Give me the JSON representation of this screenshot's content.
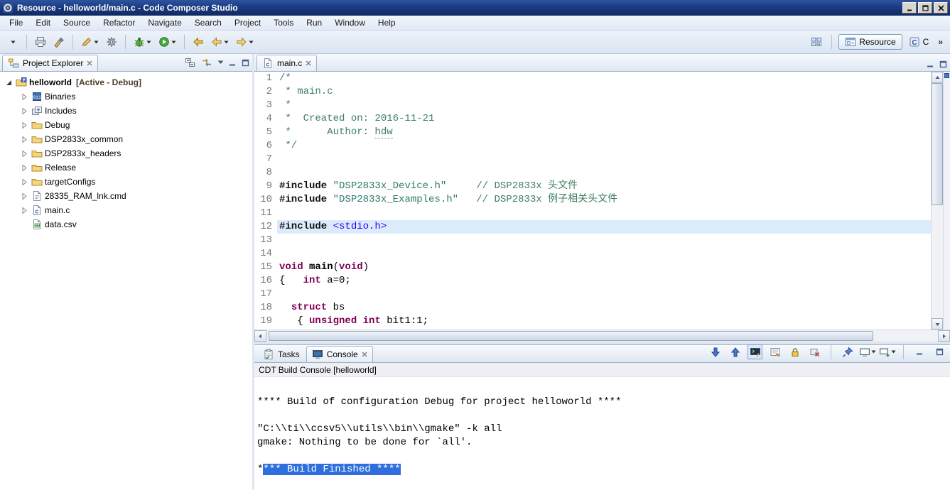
{
  "window": {
    "title": "Resource - helloworld/main.c - Code Composer Studio"
  },
  "menu": {
    "items": [
      "File",
      "Edit",
      "Source",
      "Refactor",
      "Navigate",
      "Search",
      "Project",
      "Tools",
      "Run",
      "Window",
      "Help"
    ]
  },
  "toolbar": {
    "groups": [
      [
        {
          "name": "new-button",
          "icon": "caret"
        }
      ],
      [
        {
          "name": "print-button",
          "icon": "printer"
        },
        {
          "name": "paint-button",
          "icon": "brush"
        }
      ],
      [
        {
          "name": "edit-button",
          "icon": "pencil",
          "dropdown": true
        },
        {
          "name": "settings-button",
          "icon": "gear"
        }
      ],
      [
        {
          "name": "debug-button",
          "icon": "bug",
          "dropdown": true
        },
        {
          "name": "run-button",
          "icon": "run",
          "dropdown": true
        }
      ],
      [
        {
          "name": "back-button",
          "icon": "back"
        },
        {
          "name": "back-history-button",
          "icon": "navleft",
          "dropdown": true
        },
        {
          "name": "forward-history-button",
          "icon": "navright",
          "dropdown": true
        }
      ]
    ]
  },
  "perspective_bar": {
    "resource_label": "Resource",
    "c_label": "C",
    "overflow": "»"
  },
  "project_explorer": {
    "tab_label": "Project Explorer",
    "toolbar": [
      {
        "name": "collapse-all-button",
        "icon": "collapseall"
      },
      {
        "name": "link-with-editor-button",
        "icon": "link"
      },
      {
        "name": "view-menu-button",
        "icon": "viewmenu"
      },
      {
        "name": "minimize-view-button",
        "icon": "minbtn"
      },
      {
        "name": "maximize-view-button",
        "icon": "maxbtn"
      }
    ],
    "root": {
      "label": "helloworld",
      "decoration": "[Active - Debug]"
    },
    "items": [
      {
        "label": "Binaries",
        "icon": "binaries",
        "expandable": true
      },
      {
        "label": "Includes",
        "icon": "includes",
        "expandable": true
      },
      {
        "label": "Debug",
        "icon": "folder",
        "expandable": true
      },
      {
        "label": "DSP2833x_common",
        "icon": "folder",
        "expandable": true
      },
      {
        "label": "DSP2833x_headers",
        "icon": "folder",
        "expandable": true
      },
      {
        "label": "Release",
        "icon": "folder",
        "expandable": true
      },
      {
        "label": "targetConfigs",
        "icon": "folder",
        "expandable": true
      },
      {
        "label": "28335_RAM_lnk.cmd",
        "icon": "cmd",
        "expandable": true
      },
      {
        "label": "main.c",
        "icon": "cfile",
        "expandable": true
      },
      {
        "label": "data.csv",
        "icon": "csv",
        "expandable": false
      }
    ]
  },
  "editor": {
    "tab_label": "main.c",
    "lines": [
      {
        "n": 1,
        "s": [
          {
            "t": "/*",
            "c": "cm"
          }
        ]
      },
      {
        "n": 2,
        "s": [
          {
            "t": " * main.c",
            "c": "cm"
          }
        ]
      },
      {
        "n": 3,
        "s": [
          {
            "t": " *",
            "c": "cm"
          }
        ]
      },
      {
        "n": 4,
        "s": [
          {
            "t": " *  Created on: 2016-11-21",
            "c": "cm"
          }
        ]
      },
      {
        "n": 5,
        "s": [
          {
            "t": " *      Author: ",
            "c": "cm"
          },
          {
            "t": "hdw",
            "c": "cm spell"
          }
        ]
      },
      {
        "n": 6,
        "s": [
          {
            "t": " */",
            "c": "cm"
          }
        ]
      },
      {
        "n": 7,
        "s": []
      },
      {
        "n": 8,
        "s": []
      },
      {
        "n": 9,
        "s": [
          {
            "t": "#include",
            "c": "pp"
          },
          {
            "t": " ",
            "c": ""
          },
          {
            "t": "\"DSP2833x_Device.h\"",
            "c": "str"
          },
          {
            "t": "     ",
            "c": ""
          },
          {
            "t": "// DSP2833x 头文件",
            "c": "cm"
          }
        ]
      },
      {
        "n": 10,
        "s": [
          {
            "t": "#include",
            "c": "pp"
          },
          {
            "t": " ",
            "c": ""
          },
          {
            "t": "\"DSP2833x_Examples.h\"",
            "c": "str"
          },
          {
            "t": "   ",
            "c": ""
          },
          {
            "t": "// DSP2833x 例子相关头文件",
            "c": "cm"
          }
        ]
      },
      {
        "n": 11,
        "s": []
      },
      {
        "n": 12,
        "hl": true,
        "s": [
          {
            "t": "#include",
            "c": "pp"
          },
          {
            "t": " ",
            "c": ""
          },
          {
            "t": "<stdio.h>",
            "c": "inc"
          }
        ]
      },
      {
        "n": 13,
        "s": []
      },
      {
        "n": 14,
        "s": []
      },
      {
        "n": 15,
        "s": [
          {
            "t": "void",
            "c": "kw"
          },
          {
            "t": " ",
            "c": ""
          },
          {
            "t": "main",
            "c": "fn"
          },
          {
            "t": "(",
            "c": ""
          },
          {
            "t": "void",
            "c": "kw"
          },
          {
            "t": ")",
            "c": ""
          }
        ]
      },
      {
        "n": 16,
        "s": [
          {
            "t": "{   ",
            "c": ""
          },
          {
            "t": "int",
            "c": "kw"
          },
          {
            "t": " a=0;",
            "c": ""
          }
        ]
      },
      {
        "n": 17,
        "s": []
      },
      {
        "n": 18,
        "s": [
          {
            "t": "  ",
            "c": ""
          },
          {
            "t": "struct",
            "c": "kw"
          },
          {
            "t": " bs",
            "c": ""
          }
        ]
      },
      {
        "n": 19,
        "s": [
          {
            "t": "   { ",
            "c": ""
          },
          {
            "t": "unsigned",
            "c": "kw"
          },
          {
            "t": " ",
            "c": ""
          },
          {
            "t": "int",
            "c": "kw"
          },
          {
            "t": " bit1:1;",
            "c": ""
          }
        ]
      }
    ]
  },
  "console": {
    "tasks_tab": "Tasks",
    "console_tab": "Console",
    "header": "CDT Build Console [helloworld]",
    "toolbar": [
      {
        "name": "show-console-on-output-button",
        "icon": "arrdown"
      },
      {
        "name": "show-console-on-error-button",
        "icon": "arrup"
      },
      {
        "name": "terminal-button",
        "icon": "terminal",
        "active": true
      },
      {
        "name": "clear-console-button",
        "icon": "clearco"
      },
      {
        "name": "scroll-lock-button",
        "icon": "lock"
      },
      {
        "name": "remove-console-button",
        "icon": "removeco"
      },
      {
        "name": "sep"
      },
      {
        "name": "pin-console-button",
        "icon": "pin"
      },
      {
        "name": "display-console-button",
        "icon": "monitor",
        "dropdown": true
      },
      {
        "name": "open-console-button",
        "icon": "monitorplus",
        "dropdown": true
      },
      {
        "name": "sep"
      },
      {
        "name": "minimize-console-button",
        "icon": "minbtn"
      },
      {
        "name": "maximize-console-button",
        "icon": "maxbtn"
      }
    ],
    "lines": [
      {
        "s": []
      },
      {
        "s": [
          {
            "t": "**** Build of configuration Debug for project helloworld ****",
            "c": ""
          }
        ]
      },
      {
        "s": []
      },
      {
        "s": [
          {
            "t": "\"C:\\\\ti\\\\ccsv5\\\\utils\\\\bin\\\\gmake\" -k all",
            "c": ""
          }
        ]
      },
      {
        "s": [
          {
            "t": "gmake: Nothing to be done for `all'.",
            "c": ""
          }
        ]
      },
      {
        "s": []
      },
      {
        "s": [
          {
            "t": "*",
            "c": ""
          },
          {
            "t": "*** Build Finished ****",
            "c": "sel"
          }
        ]
      }
    ]
  }
}
